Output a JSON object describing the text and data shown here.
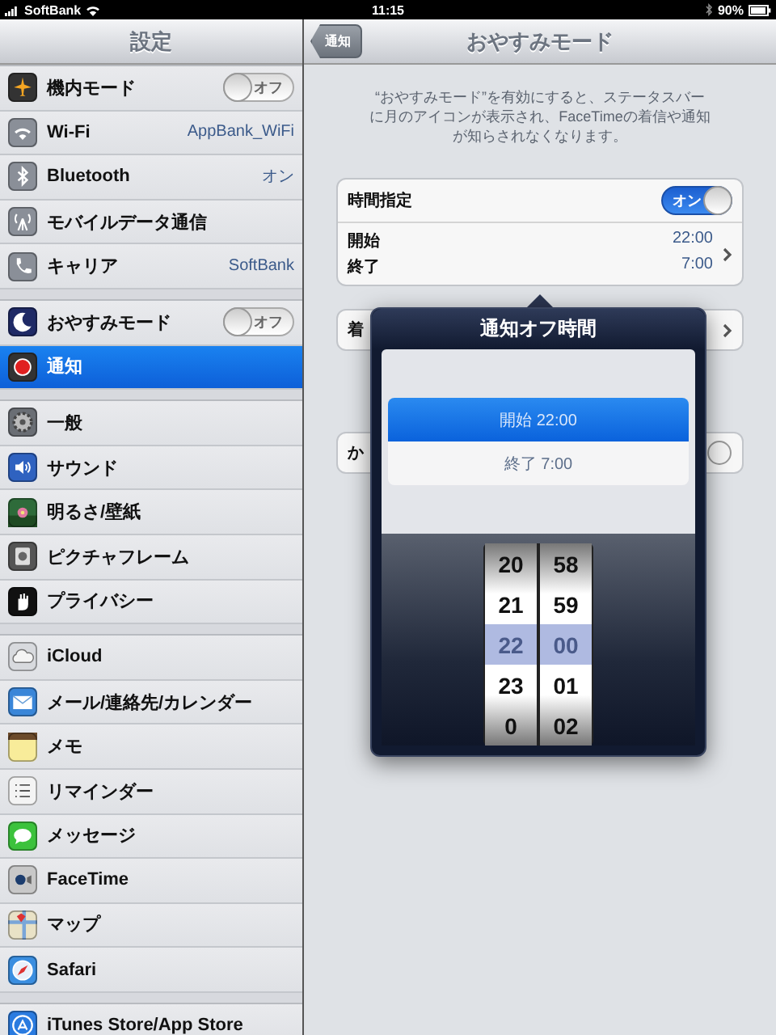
{
  "status_bar": {
    "carrier": "SoftBank",
    "time": "11:15",
    "battery": "90%"
  },
  "sidebar": {
    "title": "設定",
    "groups": [
      {
        "items": [
          {
            "label": "機内モード",
            "kind": "switch",
            "on": false,
            "switch_label": "オフ",
            "selected": false
          },
          {
            "label": "Wi-Fi",
            "kind": "value",
            "value": "AppBank_WiFi",
            "selected": false
          },
          {
            "label": "Bluetooth",
            "kind": "value",
            "value": "オン",
            "selected": false
          },
          {
            "label": "モバイルデータ通信",
            "kind": "plain",
            "selected": false
          },
          {
            "label": "キャリア",
            "kind": "value",
            "value": "SoftBank",
            "selected": false
          }
        ]
      },
      {
        "items": [
          {
            "label": "おやすみモード",
            "kind": "switch",
            "on": false,
            "switch_label": "オフ",
            "selected": false
          },
          {
            "label": "通知",
            "kind": "plain",
            "selected": true
          }
        ]
      },
      {
        "items": [
          {
            "label": "一般",
            "kind": "plain",
            "selected": false
          },
          {
            "label": "サウンド",
            "kind": "plain",
            "selected": false
          },
          {
            "label": "明るさ/壁紙",
            "kind": "plain",
            "selected": false
          },
          {
            "label": "ピクチャフレーム",
            "kind": "plain",
            "selected": false
          },
          {
            "label": "プライバシー",
            "kind": "plain",
            "selected": false
          }
        ]
      },
      {
        "items": [
          {
            "label": "iCloud",
            "kind": "plain",
            "selected": false
          },
          {
            "label": "メール/連絡先/カレンダー",
            "kind": "plain",
            "selected": false
          },
          {
            "label": "メモ",
            "kind": "plain",
            "selected": false
          },
          {
            "label": "リマインダー",
            "kind": "plain",
            "selected": false
          },
          {
            "label": "メッセージ",
            "kind": "plain",
            "selected": false
          },
          {
            "label": "FaceTime",
            "kind": "plain",
            "selected": false
          },
          {
            "label": "マップ",
            "kind": "plain",
            "selected": false
          },
          {
            "label": "Safari",
            "kind": "plain",
            "selected": false
          }
        ]
      },
      {
        "items": [
          {
            "label": "iTunes Store/App Store",
            "kind": "plain",
            "selected": false
          }
        ]
      }
    ]
  },
  "detail": {
    "back_button": "通知",
    "title": "おやすみモード",
    "description": "“おやすみモード”を有効にすると、ステータスバーに月のアイコンが表示され、FaceTimeの着信や通知が知らされなくなります。",
    "schedule": {
      "label": "時間指定",
      "on": true,
      "switch_label": "オン",
      "start_label": "開始",
      "start_value": "22:00",
      "end_label": "終了",
      "end_value": "7:00"
    },
    "row_2_label": "着",
    "row_3_label": "か"
  },
  "popover": {
    "title": "通知オフ時間",
    "segments": [
      {
        "label": "開始 22:00",
        "selected": true
      },
      {
        "label": "終了 7:00",
        "selected": false
      }
    ],
    "picker": {
      "hours": [
        {
          "label": "20",
          "selected": false
        },
        {
          "label": "21",
          "selected": false
        },
        {
          "label": "22",
          "selected": true
        },
        {
          "label": "23",
          "selected": false
        },
        {
          "label": "0",
          "selected": false
        }
      ],
      "minutes": [
        {
          "label": "58",
          "selected": false
        },
        {
          "label": "59",
          "selected": false
        },
        {
          "label": "00",
          "selected": true
        },
        {
          "label": "01",
          "selected": false
        },
        {
          "label": "02",
          "selected": false
        }
      ]
    }
  }
}
